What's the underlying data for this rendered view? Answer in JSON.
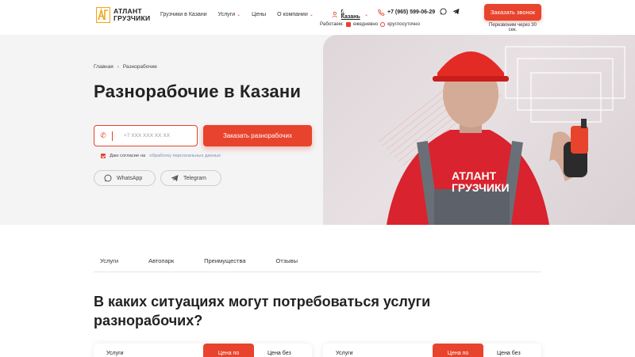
{
  "header": {
    "logo_line1": "АТЛАНТ",
    "logo_line2": "ГРУЗЧИКИ",
    "nav": [
      {
        "label": "Грузчики в Казани",
        "has_dropdown": false
      },
      {
        "label": "Услуги",
        "has_dropdown": true
      },
      {
        "label": "Цены",
        "has_dropdown": false
      },
      {
        "label": "О компании",
        "has_dropdown": true
      }
    ],
    "city": "г. Казань",
    "phone": "+7 (965) 599-06-29",
    "worktime_label": "Работаем:",
    "worktime_days": "ежедневно",
    "worktime_hours": "круглосуточно",
    "call_button": "Заказать звонок",
    "call_note": "Перезвоним через 30 сек."
  },
  "hero": {
    "breadcrumb": [
      "Главная",
      "Разнорабочие"
    ],
    "title": "Разнорабочие в Казани",
    "phone_placeholder": "+7 XXX XXX XX XX",
    "order_button": "Заказать разнорабочих",
    "consent_text": "Даю согласие на",
    "consent_link": "обработку персональных данных",
    "whatsapp_label": "WhatsApp",
    "telegram_label": "Telegram"
  },
  "tabs": [
    "Услуги",
    "Автопарк",
    "Преимущества",
    "Отзывы"
  ],
  "section": {
    "title": "В каких ситуациях могут потребоваться услуги разнорабочих?"
  },
  "cards": [
    {
      "label": "Услуги",
      "highlight": "Цена по",
      "alt": "Цена без"
    },
    {
      "label": "Услуги",
      "highlight": "Цена по",
      "alt": "Цена без"
    }
  ],
  "colors": {
    "accent": "#e8432c",
    "hero_bg": "#f4f4f5",
    "text": "#222222"
  }
}
